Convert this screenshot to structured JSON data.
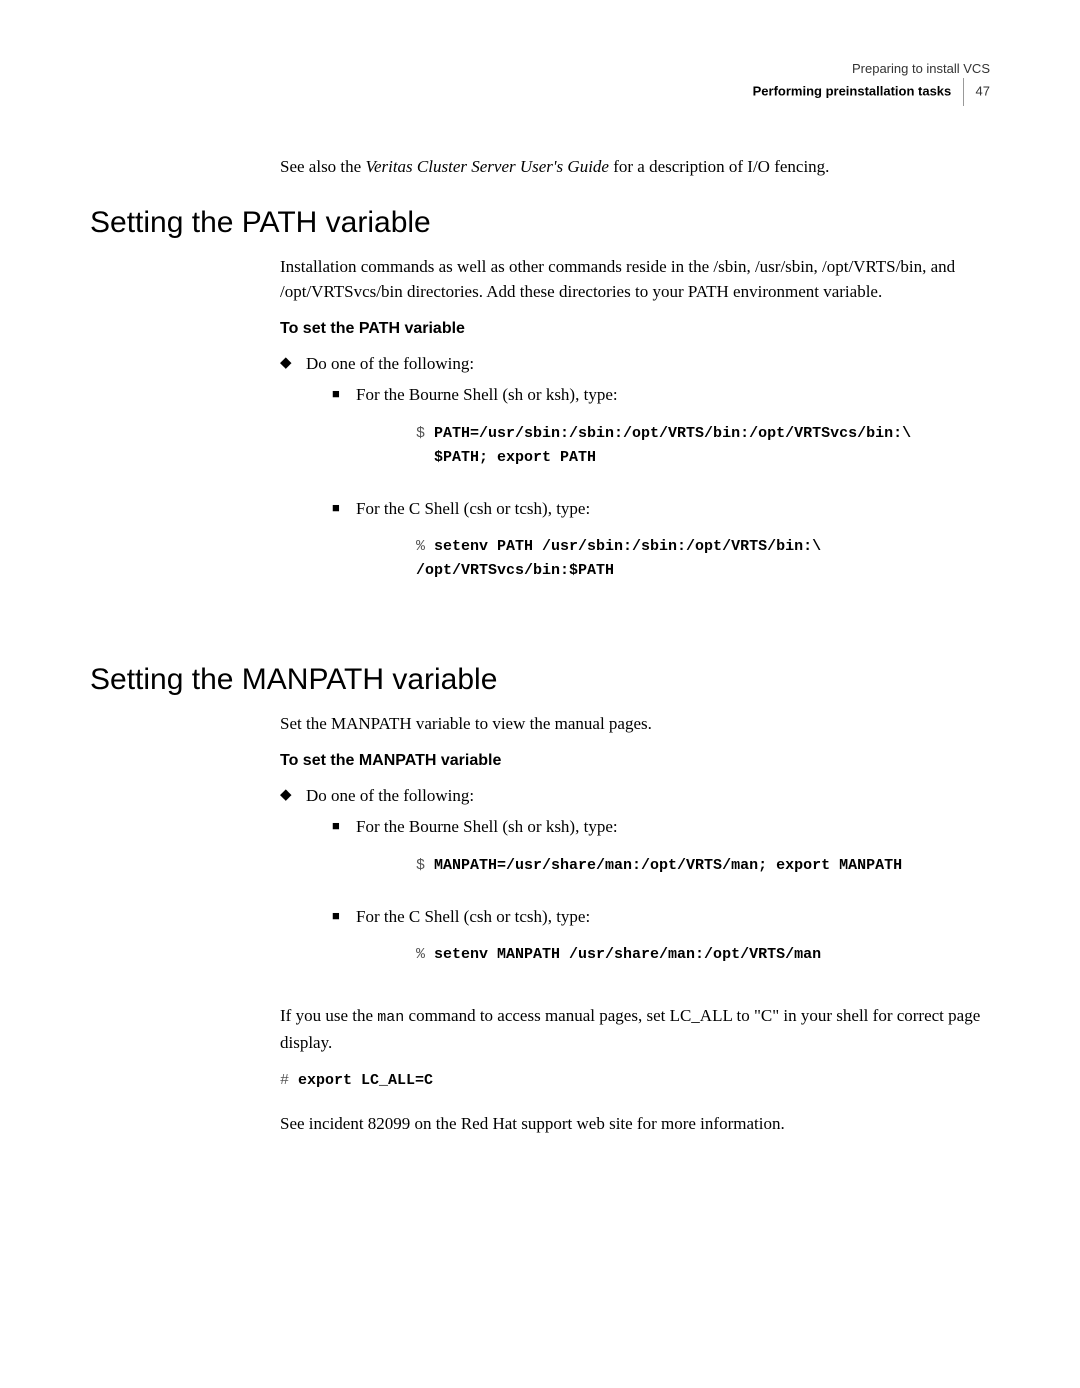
{
  "header": {
    "line1": "Preparing to install VCS",
    "line2": "Performing preinstallation tasks",
    "page_num": "47"
  },
  "intro": {
    "prefix": "See also the ",
    "italic": "Veritas Cluster Server User's Guide",
    "suffix": " for a description of I/O fencing."
  },
  "section1": {
    "title": "Setting the PATH variable",
    "para": "Installation commands as well as other commands reside in the /sbin, /usr/sbin, /opt/VRTS/bin, and /opt/VRTSvcs/bin directories. Add these directories to your PATH environment variable.",
    "subhead": "To set the PATH variable",
    "l1": "Do one of the following:",
    "l2a": "For the Bourne Shell (sh or ksh), type:",
    "code1_p": "$ ",
    "code1_l1": "PATH=/usr/sbin:/sbin:/opt/VRTS/bin:/opt/VRTSvcs/bin:\\",
    "code1_l2": "$PATH; export PATH",
    "l2b": "For the C Shell (csh or tcsh), type:",
    "code2_p": "% ",
    "code2_l1": "setenv PATH /usr/sbin:/sbin:/opt/VRTS/bin:\\",
    "code2_l2": "/opt/VRTSvcs/bin:$PATH"
  },
  "section2": {
    "title": "Setting the MANPATH variable",
    "para": "Set the MANPATH variable to view the manual pages.",
    "subhead": "To set the MANPATH variable",
    "l1": "Do one of the following:",
    "l2a": "For the Bourne Shell (sh or ksh), type:",
    "code1_p": "$ ",
    "code1": "MANPATH=/usr/share/man:/opt/VRTS/man; export MANPATH",
    "l2b": "For the C Shell (csh or tcsh), type:",
    "code2_p": "% ",
    "code2": "setenv MANPATH /usr/share/man:/opt/VRTS/man",
    "tail1a": "If you use the ",
    "tail1_code": "man",
    "tail1b": " command to access manual pages, set LC_ALL to \"C\" in your shell for correct page display.",
    "code3_p": "# ",
    "code3": "export LC_ALL=C",
    "tail2": "See incident 82099 on the Red Hat support web site for more information."
  }
}
